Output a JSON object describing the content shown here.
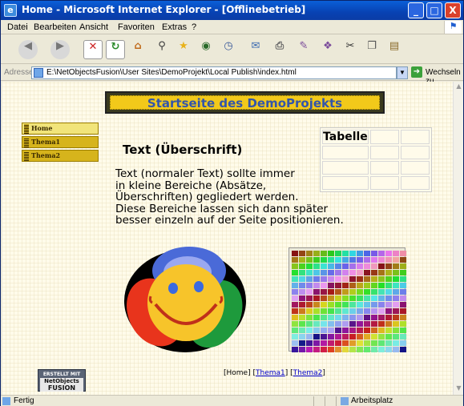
{
  "window": {
    "title": "Home - Microsoft Internet Explorer - [Offlinebetrieb]",
    "buttons": {
      "minimize": "_",
      "maximize": "□",
      "close": "X"
    }
  },
  "menu": [
    "Datei",
    "Bearbeiten",
    "Ansicht",
    "Favoriten",
    "Extras",
    "?"
  ],
  "toolbar": {
    "icons": [
      "back-icon",
      "forward-icon",
      "stop-icon",
      "refresh-icon",
      "home-icon",
      "search-icon",
      "favorites-icon",
      "media-icon",
      "history-icon",
      "mail-icon",
      "print-icon",
      "edit-icon",
      "discuss-icon",
      "cut-icon",
      "copy-icon",
      "paste-icon"
    ]
  },
  "address": {
    "label": "Adresse",
    "value": "E:\\NetObjectsFusion\\User Sites\\DemoProjekt\\Local Publish\\index.html",
    "go_label": "Wechseln zu"
  },
  "page": {
    "banner": "Startseite des DemoProjekts",
    "nav": [
      "Home",
      "Thema1",
      "Thema2"
    ],
    "heading": "Text (Überschrift)",
    "paragraph": [
      "Text (normaler Text) sollte immer",
      "in kleine Bereiche (Absätze,",
      "Überschriften) gegliedert werden.",
      "Diese Bereiche lassen sich dann später",
      "besser einzeln auf der Seite positionieren."
    ],
    "table_header": "Tabelle",
    "footer": {
      "home": "[Home]",
      "thema1": "Thema1",
      "thema2": "Thema2"
    },
    "badge": {
      "line1": "ERSTELLT MIT",
      "line2": "NetObjects",
      "line3": "FUSION"
    }
  },
  "status": {
    "text": "Fertig",
    "zone": "Arbeitsplatz"
  },
  "colors": {
    "titlebar": "#0842b3",
    "banner_bg": "#f2c91a",
    "banner_text": "#3355aa",
    "nav_bg": "#d6b41c",
    "nav_active": "#f1e47a",
    "page_bg": "#fffbea"
  }
}
